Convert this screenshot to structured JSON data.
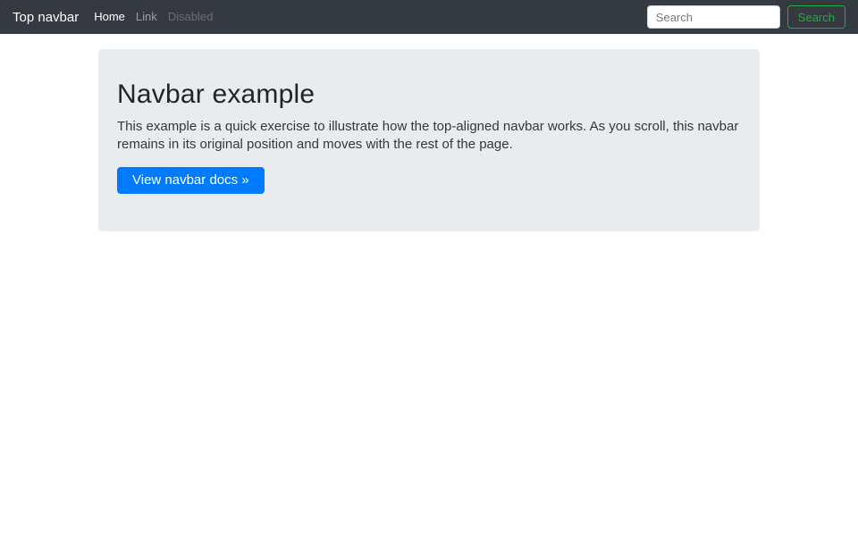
{
  "navbar": {
    "brand": "Top navbar",
    "links": [
      {
        "label": "Home",
        "state": "active"
      },
      {
        "label": "Link",
        "state": "muted"
      },
      {
        "label": "Disabled",
        "state": "disabled"
      }
    ],
    "search": {
      "placeholder": "Search",
      "button_label": "Search"
    }
  },
  "jumbotron": {
    "title": "Navbar example",
    "body": "This example is a quick exercise to illustrate how the top-aligned navbar works. As you scroll, this navbar remains in its original position and moves with the rest of the page.",
    "cta_label": "View navbar docs »"
  },
  "colors": {
    "navbar-bg": "#343a40",
    "accent-green": "#28a745",
    "primary-blue": "#007bff",
    "jumbotron-bg": "#e9ecef",
    "body-text": "#212529"
  }
}
